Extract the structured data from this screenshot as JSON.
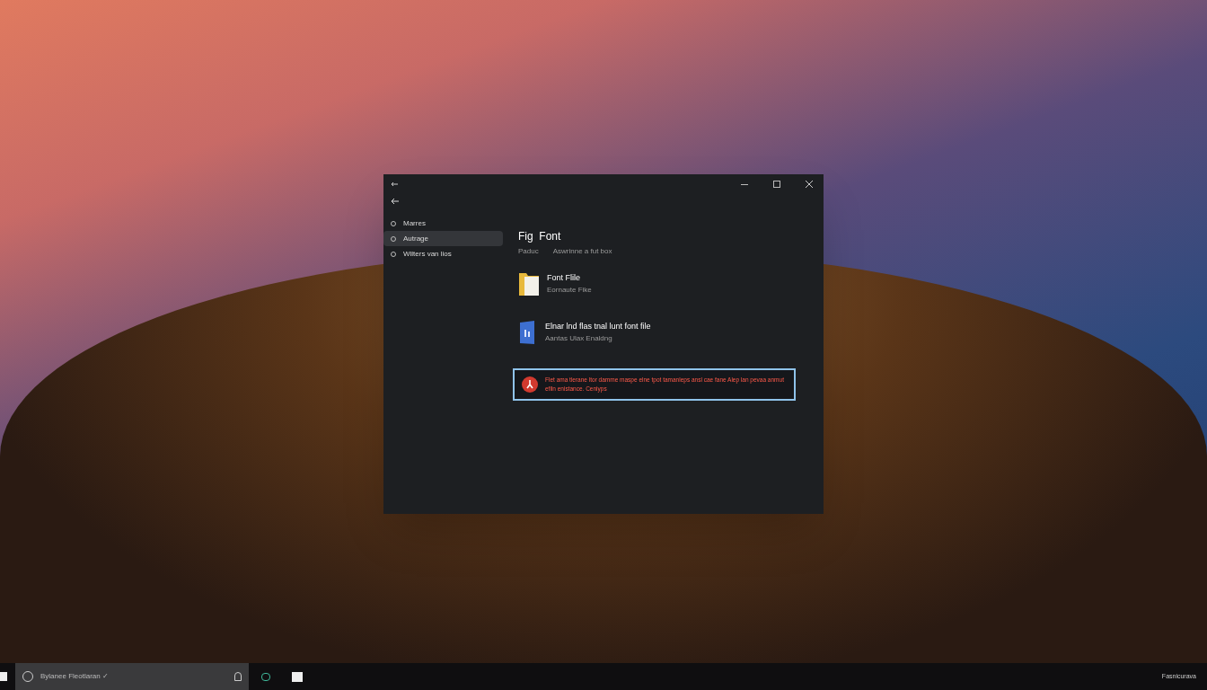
{
  "window": {
    "sidebar": {
      "items": [
        {
          "label": "Marres",
          "selected": false
        },
        {
          "label": "Autrage",
          "selected": true
        },
        {
          "label": "Wilters van lios",
          "selected": false
        }
      ]
    },
    "heading": {
      "title": "Fig  Font",
      "subtitle_1": "Paduc",
      "subtitle_2": "Aswrinne a fut box"
    },
    "options": [
      {
        "kind": "folder",
        "title": "Font Flile",
        "subtitle": "Eornaute Fike"
      },
      {
        "kind": "document",
        "title": "Elnar lnd flas tnal lunt font file",
        "subtitle": "Aantas Ulax Enaldng"
      }
    ],
    "error": {
      "message": "Flet ama tlerane ltor damme maspe elne tpot tamanleps ansl cae fane Alep lan pevaa anmut efiln enistance. Ceniyps"
    }
  },
  "taskbar": {
    "search": {
      "placeholder": "Bylanee Fleotlaran ✓"
    },
    "tray_label": "Fasnicurava"
  }
}
